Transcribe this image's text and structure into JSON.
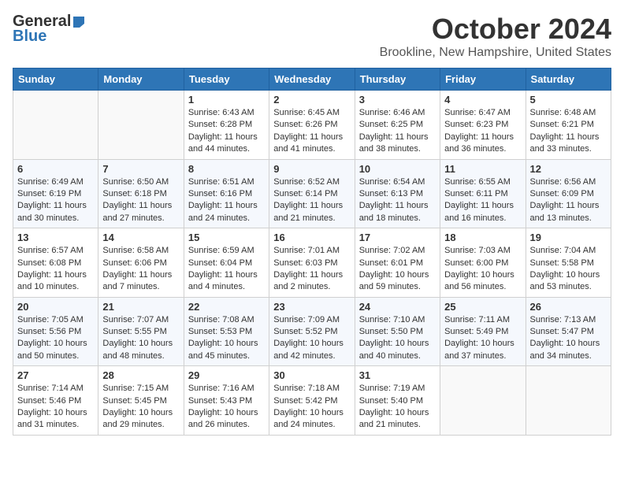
{
  "logo": {
    "general": "General",
    "blue": "Blue"
  },
  "header": {
    "month": "October 2024",
    "location": "Brookline, New Hampshire, United States"
  },
  "weekdays": [
    "Sunday",
    "Monday",
    "Tuesday",
    "Wednesday",
    "Thursday",
    "Friday",
    "Saturday"
  ],
  "weeks": [
    [
      {
        "day": "",
        "info": ""
      },
      {
        "day": "",
        "info": ""
      },
      {
        "day": "1",
        "info": "Sunrise: 6:43 AM\nSunset: 6:28 PM\nDaylight: 11 hours and 44 minutes."
      },
      {
        "day": "2",
        "info": "Sunrise: 6:45 AM\nSunset: 6:26 PM\nDaylight: 11 hours and 41 minutes."
      },
      {
        "day": "3",
        "info": "Sunrise: 6:46 AM\nSunset: 6:25 PM\nDaylight: 11 hours and 38 minutes."
      },
      {
        "day": "4",
        "info": "Sunrise: 6:47 AM\nSunset: 6:23 PM\nDaylight: 11 hours and 36 minutes."
      },
      {
        "day": "5",
        "info": "Sunrise: 6:48 AM\nSunset: 6:21 PM\nDaylight: 11 hours and 33 minutes."
      }
    ],
    [
      {
        "day": "6",
        "info": "Sunrise: 6:49 AM\nSunset: 6:19 PM\nDaylight: 11 hours and 30 minutes."
      },
      {
        "day": "7",
        "info": "Sunrise: 6:50 AM\nSunset: 6:18 PM\nDaylight: 11 hours and 27 minutes."
      },
      {
        "day": "8",
        "info": "Sunrise: 6:51 AM\nSunset: 6:16 PM\nDaylight: 11 hours and 24 minutes."
      },
      {
        "day": "9",
        "info": "Sunrise: 6:52 AM\nSunset: 6:14 PM\nDaylight: 11 hours and 21 minutes."
      },
      {
        "day": "10",
        "info": "Sunrise: 6:54 AM\nSunset: 6:13 PM\nDaylight: 11 hours and 18 minutes."
      },
      {
        "day": "11",
        "info": "Sunrise: 6:55 AM\nSunset: 6:11 PM\nDaylight: 11 hours and 16 minutes."
      },
      {
        "day": "12",
        "info": "Sunrise: 6:56 AM\nSunset: 6:09 PM\nDaylight: 11 hours and 13 minutes."
      }
    ],
    [
      {
        "day": "13",
        "info": "Sunrise: 6:57 AM\nSunset: 6:08 PM\nDaylight: 11 hours and 10 minutes."
      },
      {
        "day": "14",
        "info": "Sunrise: 6:58 AM\nSunset: 6:06 PM\nDaylight: 11 hours and 7 minutes."
      },
      {
        "day": "15",
        "info": "Sunrise: 6:59 AM\nSunset: 6:04 PM\nDaylight: 11 hours and 4 minutes."
      },
      {
        "day": "16",
        "info": "Sunrise: 7:01 AM\nSunset: 6:03 PM\nDaylight: 11 hours and 2 minutes."
      },
      {
        "day": "17",
        "info": "Sunrise: 7:02 AM\nSunset: 6:01 PM\nDaylight: 10 hours and 59 minutes."
      },
      {
        "day": "18",
        "info": "Sunrise: 7:03 AM\nSunset: 6:00 PM\nDaylight: 10 hours and 56 minutes."
      },
      {
        "day": "19",
        "info": "Sunrise: 7:04 AM\nSunset: 5:58 PM\nDaylight: 10 hours and 53 minutes."
      }
    ],
    [
      {
        "day": "20",
        "info": "Sunrise: 7:05 AM\nSunset: 5:56 PM\nDaylight: 10 hours and 50 minutes."
      },
      {
        "day": "21",
        "info": "Sunrise: 7:07 AM\nSunset: 5:55 PM\nDaylight: 10 hours and 48 minutes."
      },
      {
        "day": "22",
        "info": "Sunrise: 7:08 AM\nSunset: 5:53 PM\nDaylight: 10 hours and 45 minutes."
      },
      {
        "day": "23",
        "info": "Sunrise: 7:09 AM\nSunset: 5:52 PM\nDaylight: 10 hours and 42 minutes."
      },
      {
        "day": "24",
        "info": "Sunrise: 7:10 AM\nSunset: 5:50 PM\nDaylight: 10 hours and 40 minutes."
      },
      {
        "day": "25",
        "info": "Sunrise: 7:11 AM\nSunset: 5:49 PM\nDaylight: 10 hours and 37 minutes."
      },
      {
        "day": "26",
        "info": "Sunrise: 7:13 AM\nSunset: 5:47 PM\nDaylight: 10 hours and 34 minutes."
      }
    ],
    [
      {
        "day": "27",
        "info": "Sunrise: 7:14 AM\nSunset: 5:46 PM\nDaylight: 10 hours and 31 minutes."
      },
      {
        "day": "28",
        "info": "Sunrise: 7:15 AM\nSunset: 5:45 PM\nDaylight: 10 hours and 29 minutes."
      },
      {
        "day": "29",
        "info": "Sunrise: 7:16 AM\nSunset: 5:43 PM\nDaylight: 10 hours and 26 minutes."
      },
      {
        "day": "30",
        "info": "Sunrise: 7:18 AM\nSunset: 5:42 PM\nDaylight: 10 hours and 24 minutes."
      },
      {
        "day": "31",
        "info": "Sunrise: 7:19 AM\nSunset: 5:40 PM\nDaylight: 10 hours and 21 minutes."
      },
      {
        "day": "",
        "info": ""
      },
      {
        "day": "",
        "info": ""
      }
    ]
  ]
}
